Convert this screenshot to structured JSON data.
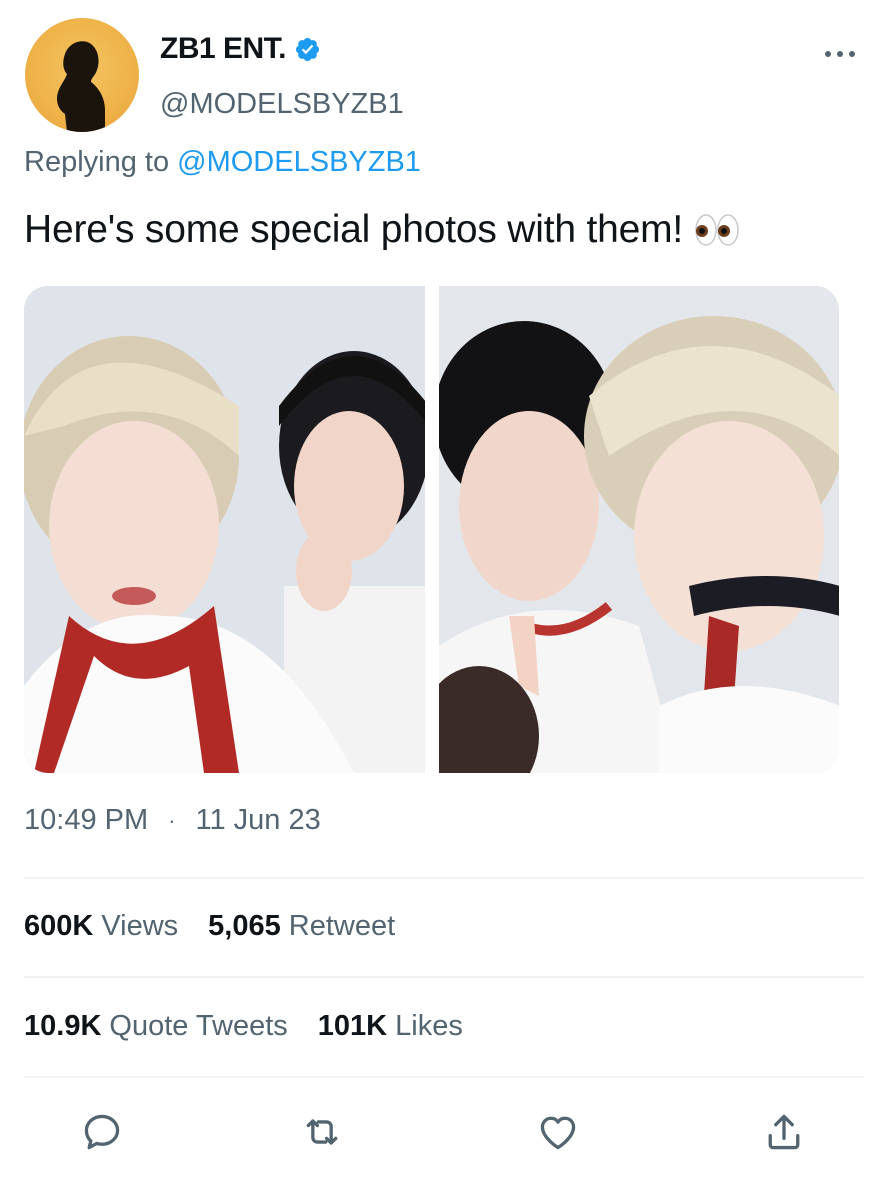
{
  "author": {
    "display_name": "ZB1 ENT.",
    "handle": "@MODELSBYZB1",
    "avatar_icon": "silhouette-avatar",
    "verified_icon": "verified-badge-icon",
    "verified_color": "#1d9bf0"
  },
  "reply": {
    "prefix": "Replying to",
    "target": "@MODELSBYZB1"
  },
  "tweet": {
    "text": "Here's some special photos with them!",
    "emoji": "eyes-emoji",
    "photos": [
      {
        "id": "photo-1"
      },
      {
        "id": "photo-2"
      }
    ],
    "time": "10:49 PM",
    "separator": "·",
    "date": "11 Jun 23"
  },
  "stats_row_1": [
    {
      "value": "600K",
      "label": "Views"
    },
    {
      "value": "5,065",
      "label": "Retweet"
    }
  ],
  "stats_row_2": [
    {
      "value": "10.9K",
      "label": "Quote Tweets"
    },
    {
      "value": "101K",
      "label": "Likes"
    }
  ],
  "actions": [
    {
      "icon": "reply-icon"
    },
    {
      "icon": "retweet-icon"
    },
    {
      "icon": "like-icon"
    },
    {
      "icon": "share-icon"
    }
  ],
  "colors": {
    "accent": "#1d9bf0",
    "secondary_text": "#536471",
    "primary_text": "#0f1419"
  }
}
